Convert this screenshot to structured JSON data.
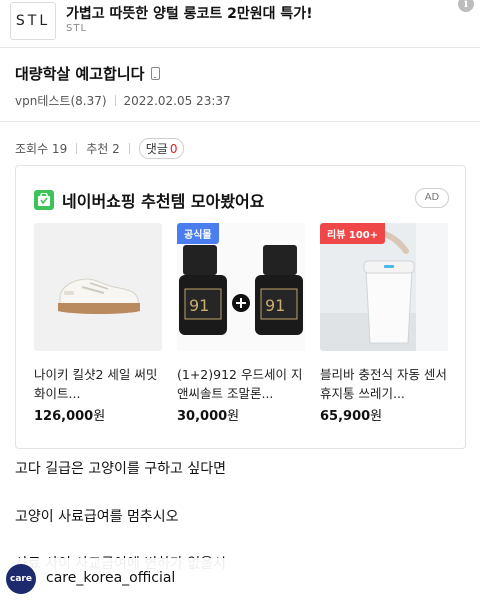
{
  "top_ad": {
    "logo_text": "STL",
    "title": "가볍고 따뜻한 양털 롱코트 2만원대 특가!",
    "brand": "STL",
    "info_icon": "info-icon"
  },
  "post": {
    "title": "대량학살 예고합니다",
    "device_icon": "mobile-phone-icon",
    "author": "vpn테스트(8.37)",
    "datetime": "2022.02.05 23:37",
    "views_label": "조회수 19",
    "recommend_label": "추천 2",
    "comment_label": "댓글",
    "comment_count": "0"
  },
  "shopping": {
    "title": "네이버쇼핑 추천템 모아봤어요",
    "ad_label": "AD",
    "products": [
      {
        "name": "나이키 킬샷2 세일 써밋 화이트...",
        "price": "126,000",
        "unit": "원",
        "badge": ""
      },
      {
        "name": "(1+2)912 우드세이 지앤씨솔트 조말론...",
        "price": "30,000",
        "unit": "원",
        "badge": "공식몰"
      },
      {
        "name": "블리바 충전식 자동 센서 휴지통 쓰레기...",
        "price": "65,900",
        "unit": "원",
        "badge": "리뷰 100+"
      }
    ]
  },
  "body_lines": [
    "고다 길급은 고양이를 구하고 싶다면",
    "고양이 사료급여를 멈추시오",
    "사료 사이 사교급여에 변하가 없을시"
  ],
  "overlay": {
    "account": "care_korea_official",
    "logo_text": "care"
  },
  "colors": {
    "naver_green": "#3ec35a",
    "badge_blue": "#4a7df0",
    "badge_red": "#f04848",
    "comment_count_red": "#e02020",
    "care_navy": "#1e2a6e"
  }
}
